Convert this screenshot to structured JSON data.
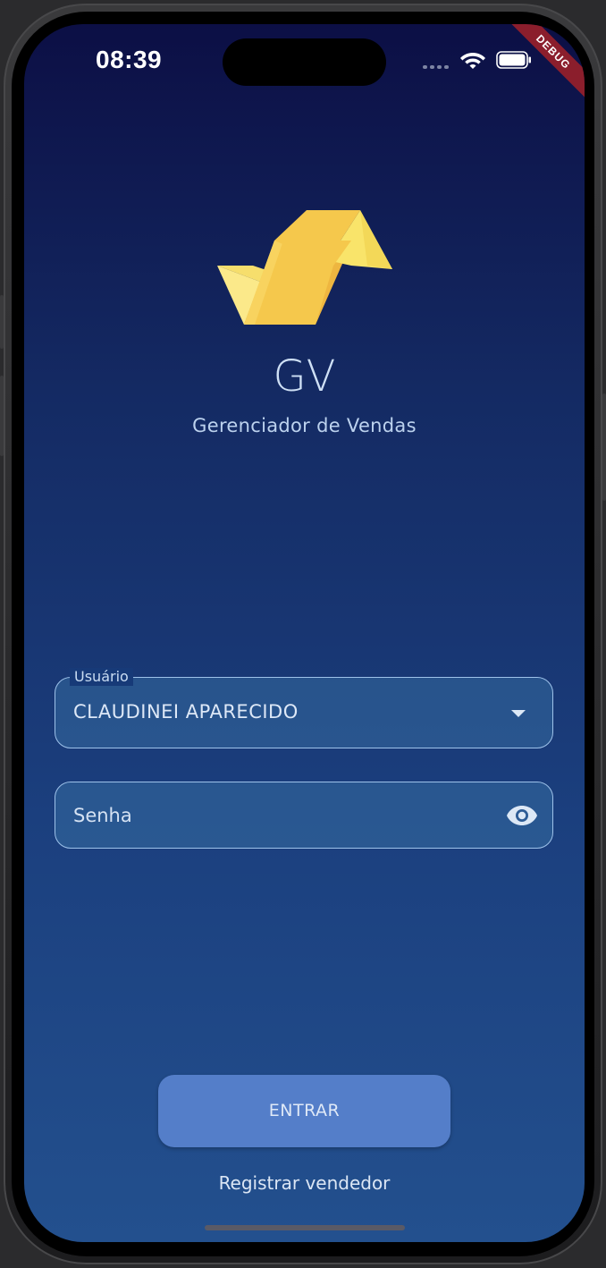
{
  "status_bar": {
    "time": "08:39",
    "debug_banner": "DEBUG"
  },
  "branding": {
    "app_name": "GV",
    "subtitle": "Gerenciador de Vendas",
    "logo_colors": [
      "#f7e26b",
      "#f4c84a",
      "#efb83a"
    ]
  },
  "form": {
    "user_field": {
      "label": "Usuário",
      "value": "CLAUDINEI APARECIDO",
      "icon": "arrow-drop-down-icon"
    },
    "password_field": {
      "placeholder": "Senha",
      "icon": "eye-icon"
    }
  },
  "actions": {
    "enter_label": "ENTRAR",
    "register_label": "Registrar vendedor"
  },
  "colors": {
    "background_top": "#0c0f45",
    "background_bottom": "#23508e",
    "button": "#547ec9",
    "field_border": "#9ec2ea"
  }
}
